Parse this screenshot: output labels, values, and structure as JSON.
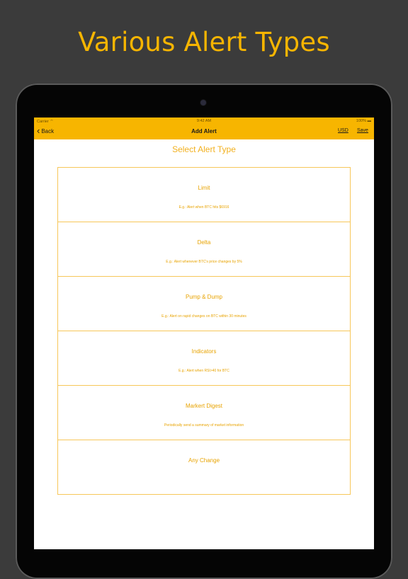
{
  "headline": "Various Alert Types",
  "status_bar": {
    "carrier": "Carrier ⌔",
    "time": "9:42 AM",
    "battery": "100% ▬"
  },
  "nav": {
    "back_label": "Back",
    "title": "Add Alert",
    "currency": "USD",
    "save_label": "Save"
  },
  "page_heading": "Select Alert Type",
  "alert_types": [
    {
      "name": "Limit",
      "description": "E.g.: Alert when BTC hits $6916"
    },
    {
      "name": "Delta",
      "description": "E.g.: Alert whenever BTC's price changes by 5%"
    },
    {
      "name": "Pump & Dump",
      "description": "E.g.: Alert on rapid changes on BTC within 30 minutes"
    },
    {
      "name": "Indicators",
      "description": "E.g.: Alert when RSI>40 for BTC"
    },
    {
      "name": "Markert Digest",
      "description": "Periodically send a summary of market information"
    },
    {
      "name": "Any Change",
      "description": ""
    }
  ],
  "colors": {
    "accent": "#f7b500",
    "background": "#3b3b3b"
  }
}
